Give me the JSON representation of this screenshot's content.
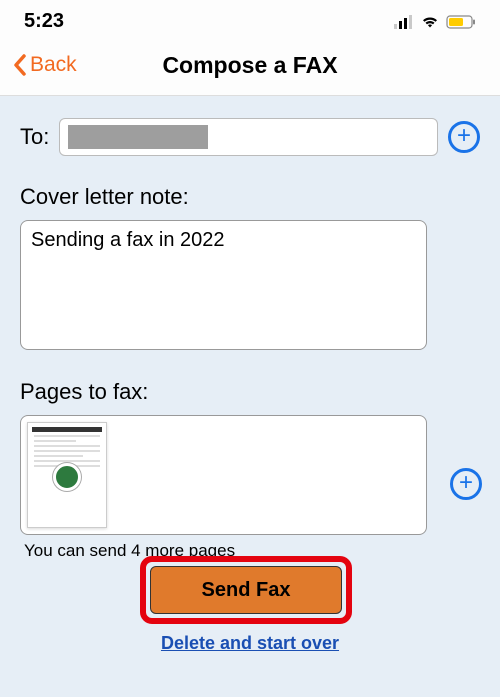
{
  "status": {
    "time": "5:23"
  },
  "nav": {
    "back_label": "Back",
    "title": "Compose a FAX"
  },
  "to": {
    "label": "To:",
    "value": ""
  },
  "cover": {
    "label": "Cover letter note:",
    "value": "Sending a fax in 2022"
  },
  "pages": {
    "label": "Pages to fax:",
    "remaining_text": "You can send 4 more pages"
  },
  "actions": {
    "send_label": "Send Fax",
    "delete_label": "Delete and start over"
  }
}
